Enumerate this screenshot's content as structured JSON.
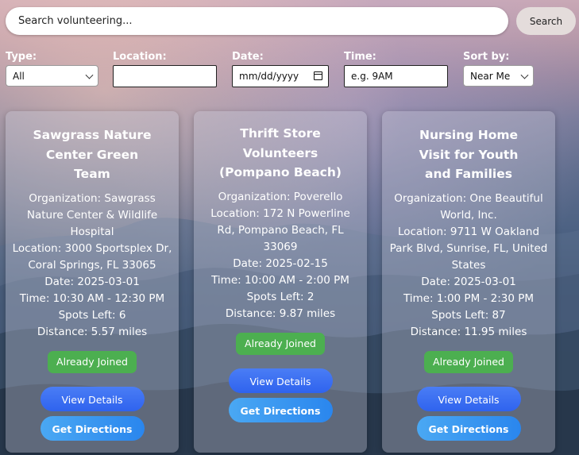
{
  "search": {
    "placeholder": "Search volunteering...",
    "button_label": "Search"
  },
  "filters": {
    "type": {
      "label": "Type:",
      "selected": "All"
    },
    "location": {
      "label": "Location:",
      "value": ""
    },
    "date": {
      "label": "Date:",
      "placeholder": "mm/dd/yyyy"
    },
    "time": {
      "label": "Time:",
      "placeholder": "e.g. 9AM"
    },
    "sort": {
      "label": "Sort by:",
      "selected": "Near Me"
    }
  },
  "cards": [
    {
      "title": "Sawgrass Nature Center Green Team",
      "organization": "Organization: Sawgrass Nature Center & Wildlife Hospital",
      "location": "Location: 3000 Sportsplex Dr, Coral Springs, FL 33065",
      "date": "Date: 2025-03-01",
      "time": "Time: 10:30 AM - 12:30 PM",
      "spots": "Spots Left: 6",
      "distance": "Distance: 5.57 miles",
      "status": "Already Joined",
      "details_label": "View Details",
      "directions_label": "Get Directions"
    },
    {
      "title": "Thrift Store Volunteers (Pompano Beach)",
      "organization": "Organization: Poverello",
      "location": "Location: 172 N Powerline Rd, Pompano Beach, FL 33069",
      "date": "Date: 2025-02-15",
      "time": "Time: 10:00 AM - 2:00 PM",
      "spots": "Spots Left: 2",
      "distance": "Distance: 9.87 miles",
      "status": "Already Joined",
      "details_label": "View Details",
      "directions_label": "Get Directions"
    },
    {
      "title": "Nursing Home Visit for Youth and Families",
      "organization": "Organization: One Beautiful World, Inc.",
      "location": "Location: 9711 W Oakland Park Blvd, Sunrise, FL, United States",
      "date": "Date: 2025-03-01",
      "time": "Time: 1:00 PM - 2:30 PM",
      "spots": "Spots Left: 87",
      "distance": "Distance: 11.95 miles",
      "status": "Already Joined",
      "details_label": "View Details",
      "directions_label": "Get Directions"
    }
  ],
  "colors": {
    "joined_badge": "#4caf50",
    "details_button": "#2f63ee",
    "directions_button": "#2a86ee"
  },
  "icons": {
    "type_select": "chevron-down-icon",
    "sort_select": "chevron-down-icon",
    "date_picker": "calendar-icon"
  }
}
